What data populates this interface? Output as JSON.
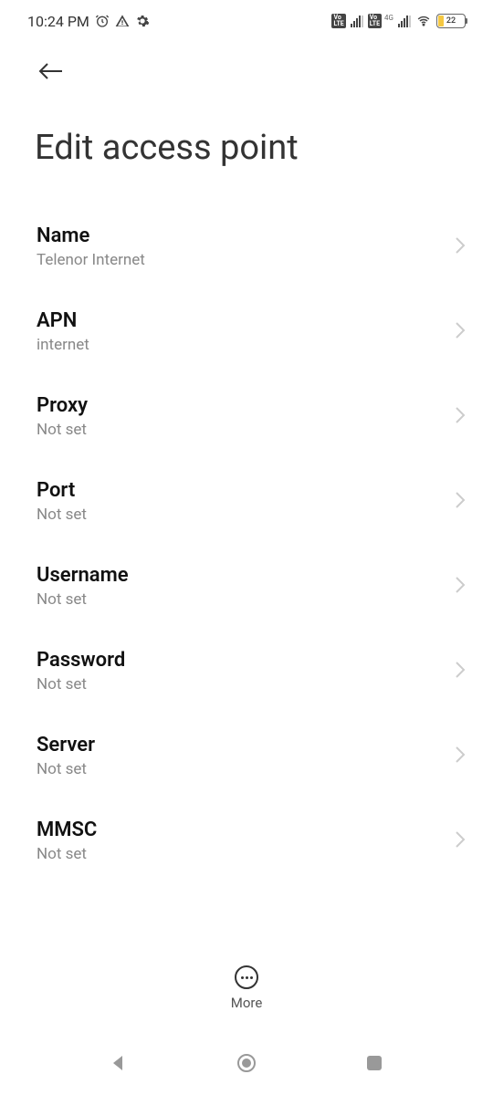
{
  "status": {
    "time": "10:24 PM",
    "battery_pct": "22",
    "network_label": "4G"
  },
  "page": {
    "title": "Edit access point"
  },
  "bottom": {
    "more_label": "More"
  },
  "settings": [
    {
      "label": "Name",
      "value": "Telenor Internet"
    },
    {
      "label": "APN",
      "value": "internet"
    },
    {
      "label": "Proxy",
      "value": "Not set"
    },
    {
      "label": "Port",
      "value": "Not set"
    },
    {
      "label": "Username",
      "value": "Not set"
    },
    {
      "label": "Password",
      "value": "Not set"
    },
    {
      "label": "Server",
      "value": "Not set"
    },
    {
      "label": "MMSC",
      "value": "Not set"
    }
  ]
}
